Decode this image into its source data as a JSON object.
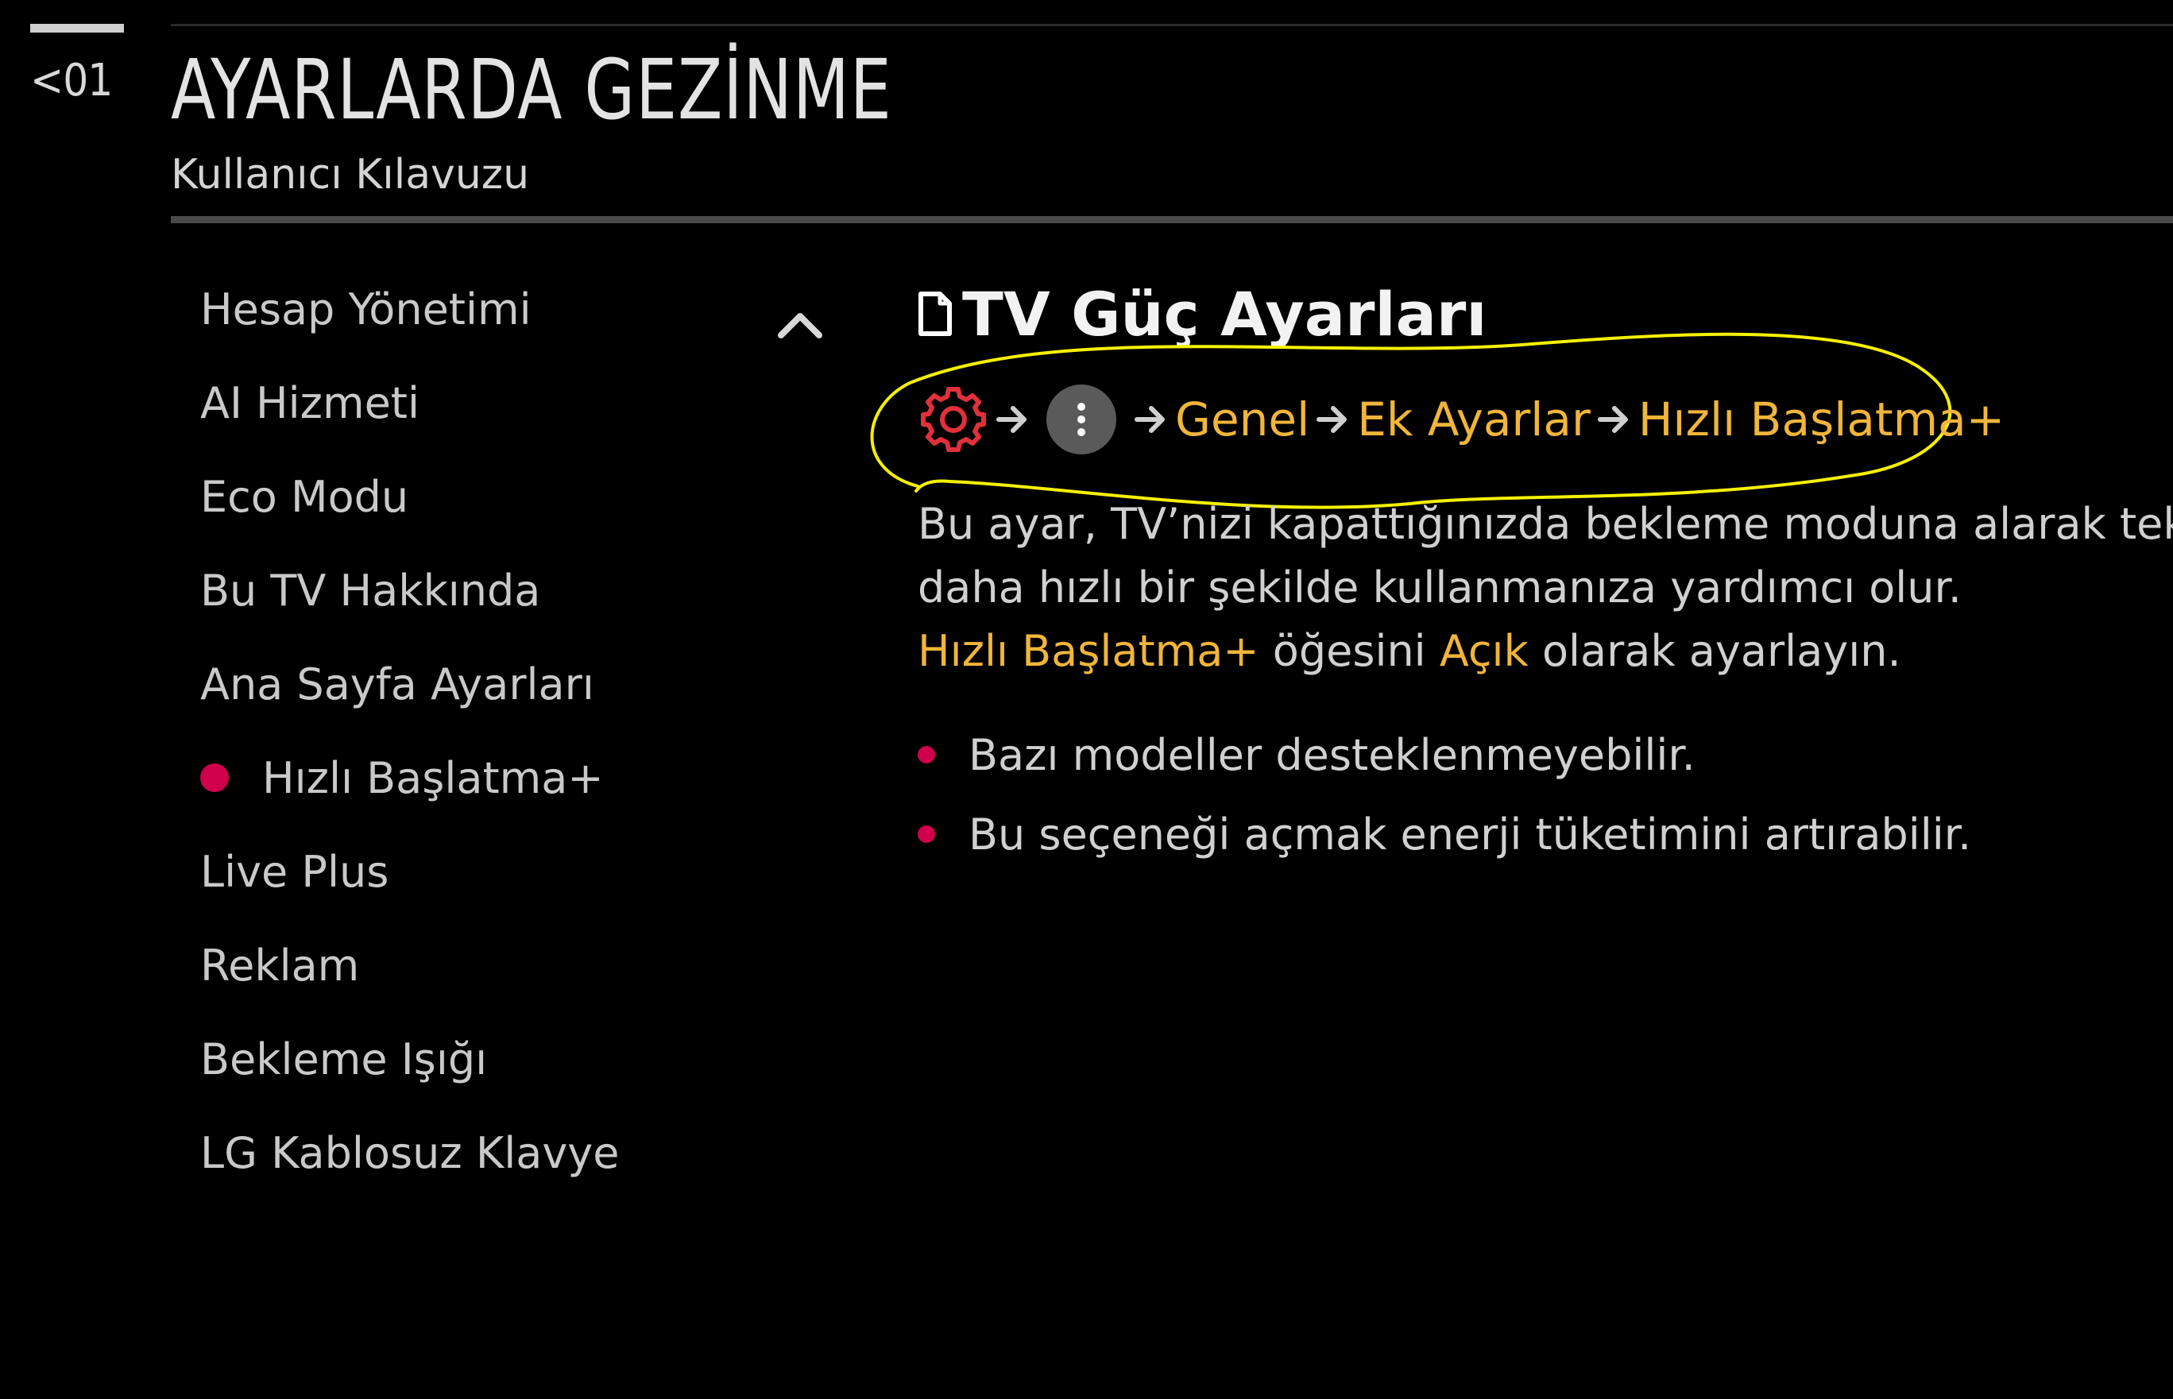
{
  "header": {
    "back_label": "<01",
    "title": "AYARLARDA GEZİNME",
    "subtitle": "Kullanıcı Kılavuzu"
  },
  "sidebar": {
    "items": [
      {
        "label": "Hesap Yönetimi",
        "active": false
      },
      {
        "label": "AI Hizmeti",
        "active": false
      },
      {
        "label": "Eco Modu",
        "active": false
      },
      {
        "label": "Bu TV Hakkında",
        "active": false
      },
      {
        "label": "Ana Sayfa Ayarları",
        "active": false
      },
      {
        "label": "Hızlı Başlatma+",
        "active": true
      },
      {
        "label": "Live Plus",
        "active": false
      },
      {
        "label": "Reklam",
        "active": false
      },
      {
        "label": "Bekleme Işığı",
        "active": false
      },
      {
        "label": "LG Kablosuz Klavye",
        "active": false
      }
    ]
  },
  "content": {
    "title": "TV Güç Ayarları",
    "path": {
      "step1": "Genel",
      "step2": "Ek Ayarlar",
      "step3": "Hızlı Başlatma+"
    },
    "description": {
      "line1": "Bu ayar, TV’nizi kapattığınızda bekleme moduna alarak tekrar",
      "line2": "daha hızlı bir şekilde kullanmanıza yardımcı olur.",
      "line3_option": "Hızlı Başlatma+",
      "line3_mid": " öğesini ",
      "line3_value": "Açık",
      "line3_end": " olarak ayarlayın."
    },
    "notes": [
      "Bazı modeller desteklenmeyebilir.",
      "Bu seçeneği açmak enerji tüketimini artırabilir."
    ]
  },
  "colors": {
    "background": "#000000",
    "accent": "#f0b53a",
    "bullet": "#d0004d",
    "gear": "#e0303a",
    "highlight": "#f4f000"
  },
  "icons": [
    "back-icon",
    "chevron-up-icon",
    "document-icon",
    "gear-icon",
    "arrow-right-icon",
    "more-vertical-icon"
  ]
}
